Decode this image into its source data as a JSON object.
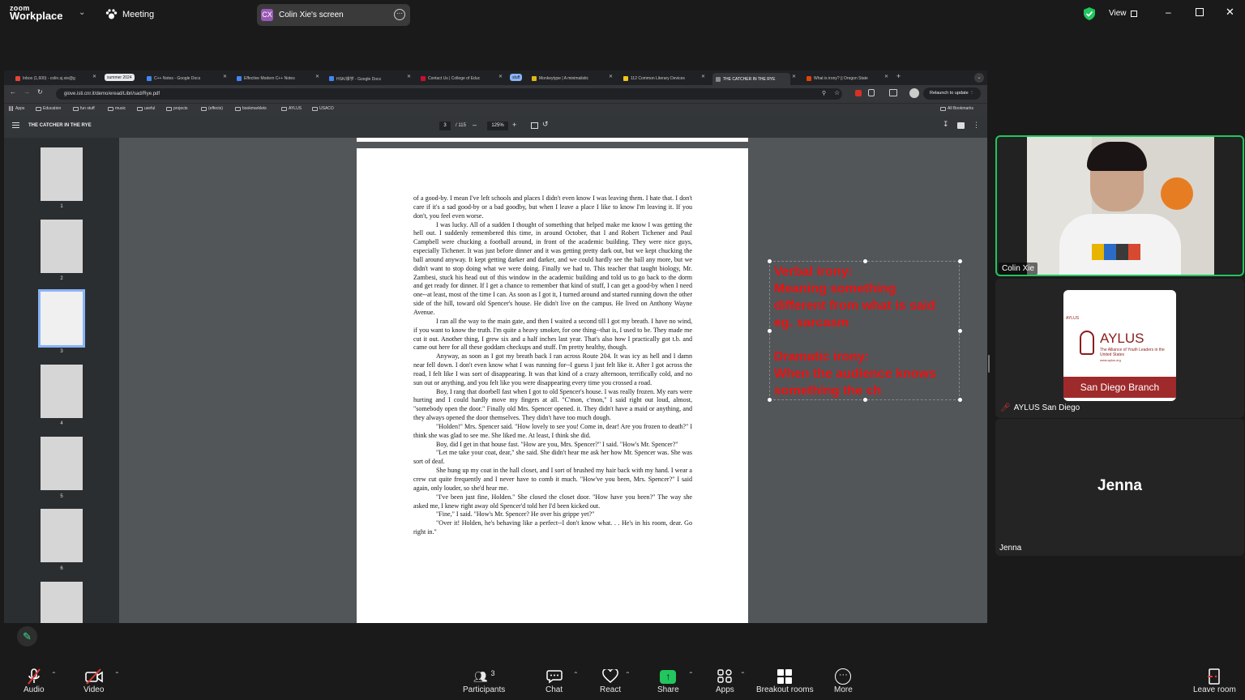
{
  "zoom": {
    "logo_small": "zoom",
    "logo_big": "Workplace",
    "meeting_label": "Meeting",
    "share_badge_initials": "CX",
    "share_label": "Colin Xie's screen",
    "view_label": "View"
  },
  "browser": {
    "tabs": [
      {
        "label": "Inbox (1,600) - colin.sj.xie@g",
        "fav_color": "#ea4335"
      },
      {
        "label": "C++ Notes - Google Docs",
        "fav_color": "#4285f4"
      },
      {
        "label": "Effective Modern C++ Notes",
        "fav_color": "#4285f4"
      },
      {
        "label": "HSK/课学 - Google Docs",
        "fav_color": "#4285f4"
      },
      {
        "label": "Contact Us | College of Educ",
        "fav_color": "#c8102e"
      },
      {
        "label": "Monkeytype | A minimalistic",
        "fav_color": "#e2b714"
      },
      {
        "label": "112 Common Literary Devices",
        "fav_color": "#f5c518"
      },
      {
        "label": "THE CATCHER IN THE RYE",
        "fav_color": "#888888"
      },
      {
        "label": "What is irony? || Oregon State",
        "fav_color": "#dc4405"
      }
    ],
    "groups": [
      "summer 2024",
      "stuff"
    ],
    "url": "giove.isti.cnr.it/demo/eread/Libri/sad/Rye.pdf",
    "relaunch_label": "Relaunch to update",
    "bookmarks": [
      "Apps",
      "Education",
      "fun stuff",
      "music",
      "useful",
      "projects",
      "(effects)",
      "bookmarklets",
      "AYLUS",
      "USACO"
    ],
    "all_bookmarks": "All Bookmarks"
  },
  "pdf": {
    "title": "THE CATCHER IN THE RYE",
    "page_current": "3",
    "page_total": "/ 115",
    "zoom": "125%",
    "thumb_labels": [
      "1",
      "2",
      "3",
      "4",
      "5",
      "6"
    ],
    "paragraphs": [
      "of a good-by. I mean I've left schools and places I didn't even know I was leaving them. I hate that. I don't care if it's a sad good-by or a bad goodby, but when I leave a place I like to know I'm leaving it. If you don't, you feel even worse.",
      "I was lucky. All of a sudden I thought of something that helped make me know I was getting the hell out. I suddenly remembered this time, in around October, that I and Robert Tichener and Paul Campbell were chucking a football around, in front of the academic building. They were nice guys, especially Tichener. It was just before dinner and it was getting pretty dark out, but we kept chucking the ball around anyway. It kept getting darker and darker, and we could hardly see the ball any more, but we didn't want to stop doing what we were doing. Finally we had to. This teacher that taught biology, Mr. Zambesi, stuck his head out of this window in the academic building and told us to go back to the dorm and get ready for dinner. If I get a chance to remember that kind of stuff, I can get a good-by when I need one--at least, most of the time I can. As soon as I got it, I turned around and started running down the other side of the hill, toward old Spencer's house. He didn't live on the campus. He lived on Anthony Wayne Avenue.",
      "I ran all the way to the main gate, and then I waited a second till I got my breath. I have no wind, if you want to know the truth. I'm quite a heavy smoker, for one thing--that is, I used to be. They made me cut it out. Another thing, I grew six and a half inches last year. That's also how I practically got t.b. and came out here for all these goddam checkups and stuff. I'm pretty healthy, though.",
      "Anyway, as soon as I got my breath back I ran across Route 204. It was icy as hell and I damn near fell down. I don't even know what I was running for--I guess I just felt like it. After I got across the road, I felt like I was sort of disappearing. It was that kind of a crazy afternoon, terrifically cold, and no sun out or anything, and you felt like you were disappearing every time you crossed a road.",
      "Boy, I rang that doorbell fast when I got to old Spencer's house. I was really frozen. My ears were hurting and I could hardly move my fingers at all. \"C'mon, c'mon,\" I said right out loud, almost, \"somebody open the door.\" Finally old Mrs. Spencer opened. it. They didn't have a maid or anything, and they always opened the door themselves. They didn't have too much dough.",
      "\"Holden!\" Mrs. Spencer said. \"How lovely to see you! Come in, dear! Are you frozen to death?\" I think she was glad to see me. She liked me. At least, I think she did.",
      "Boy, did I get in that house fast. \"How are you, Mrs. Spencer?\" I said. \"How's Mr. Spencer?\"",
      "\"Let me take your coat, dear,\" she said. She didn't hear me ask her how Mr. Spencer was. She was sort of deaf.",
      "She hung up my coat in the hall closet, and I sort of brushed my hair back with my hand. I wear a crew cut quite frequently and I never have to comb it much. \"How've you been, Mrs. Spencer?\" I said again, only louder, so she'd hear me.",
      "\"I've been just fine, Holden.\" She closed the closet door. \"How have you been?\" The way she asked me, I knew right away old Spencer'd told her I'd been kicked out.",
      "\"Fine,\" I said. \"How's Mr. Spencer? He over his grippe yet?\"",
      "\"Over it! Holden, he's behaving like a perfect--I don't know what. . . He's in his room, dear. Go right in.\""
    ]
  },
  "annotation": {
    "text": "Verbal irony:\nMeaning something\ndifferent from what is said\neg. sarcasm\n\nDramatic irony:\nWhen the audience knows\nsomething the ch"
  },
  "participants": {
    "colin": "Colin Xie",
    "aylus_name": "AYLUS San Diego",
    "aylus_logo_title": "AYLUS",
    "aylus_logo_sub": "The Alliance of Youth Leaders in the United States",
    "aylus_logo_url": "www.aylus.org",
    "aylus_logo_small": "AYLUS",
    "aylus_branch": "San Diego Branch",
    "jenna_big": "Jenna",
    "jenna_name": "Jenna"
  },
  "toolbar": {
    "audio": "Audio",
    "video": "Video",
    "participants": "Participants",
    "participant_count": "3",
    "chat": "Chat",
    "react": "React",
    "share": "Share",
    "apps": "Apps",
    "breakout": "Breakout rooms",
    "more": "More",
    "leave": "Leave room"
  }
}
